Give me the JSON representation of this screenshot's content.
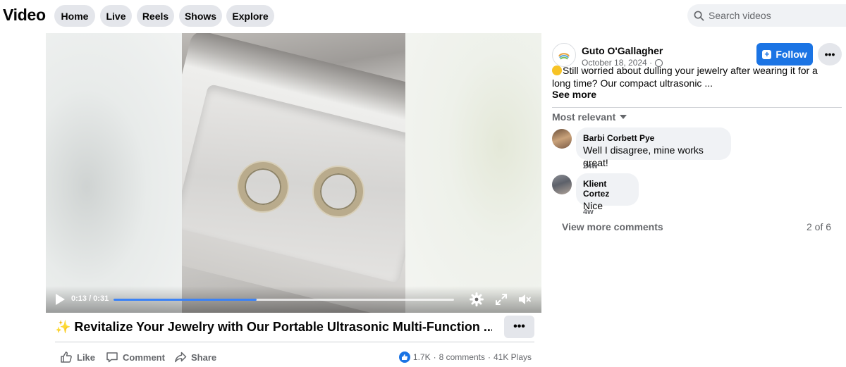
{
  "header": {
    "title": "Video",
    "nav": [
      "Home",
      "Live",
      "Reels",
      "Shows",
      "Explore"
    ],
    "search_placeholder": "Search videos"
  },
  "player": {
    "time": "0:13 / 0:31",
    "progress_fraction": 0.42
  },
  "video": {
    "title": "✨ Revitalize Your Jewelry with Our Portable Ultrasonic Multi-Function ...",
    "more_label": "•••",
    "actions": {
      "like": "Like",
      "comment": "Comment",
      "share": "Share"
    },
    "reactions": "1.7K",
    "comments": "8 comments",
    "separator": "·",
    "plays": "41K Plays"
  },
  "post": {
    "author": "Guto O'Gallagher",
    "date": "October 18, 2024 ·",
    "follow_label": "Follow",
    "more_label": "•••",
    "text": "Still worried about dulling your jewelry after wearing it for a long time? Our compact ultrasonic ...",
    "see_more": "See more",
    "sort_label": "Most relevant"
  },
  "comments": [
    {
      "name": "Barbi Corbett Pye",
      "text": "Well I disagree, mine works great!",
      "time": "24w"
    },
    {
      "name": "Klient Cortez",
      "text": "Nice",
      "time": "4w"
    }
  ],
  "footer": {
    "view_more": "View more comments",
    "count": "2 of 6"
  },
  "colors": {
    "accent": "#1b74e4",
    "pill": "#e4e6eb",
    "secondary_text": "#65676b",
    "progress": "#3b82f6"
  }
}
